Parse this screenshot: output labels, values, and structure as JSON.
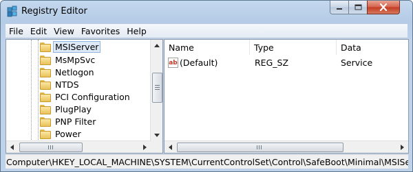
{
  "window": {
    "title": "Registry Editor",
    "icon": "registry-editor-icon"
  },
  "menu": [
    {
      "label": "File"
    },
    {
      "label": "Edit"
    },
    {
      "label": "View"
    },
    {
      "label": "Favorites"
    },
    {
      "label": "Help"
    }
  ],
  "tree": {
    "items": [
      {
        "label": "MSIServer",
        "selected": true
      },
      {
        "label": "MsMpSvc"
      },
      {
        "label": "Netlogon"
      },
      {
        "label": "NTDS"
      },
      {
        "label": "PCI Configuration"
      },
      {
        "label": "PlugPlay"
      },
      {
        "label": "PNP Filter"
      },
      {
        "label": "Power"
      }
    ]
  },
  "list": {
    "columns": [
      "Name",
      "Type",
      "Data"
    ],
    "rows": [
      {
        "name": "(Default)",
        "type": "REG_SZ",
        "data": "Service",
        "icon": "string-value-icon"
      }
    ]
  },
  "status": {
    "path": "Computer\\HKEY_LOCAL_MACHINE\\SYSTEM\\CurrentControlSet\\Control\\SafeBoot\\Minimal\\MSIServer"
  },
  "colors": {
    "selection": "#dde9f6",
    "close_button": "#c23b22"
  }
}
